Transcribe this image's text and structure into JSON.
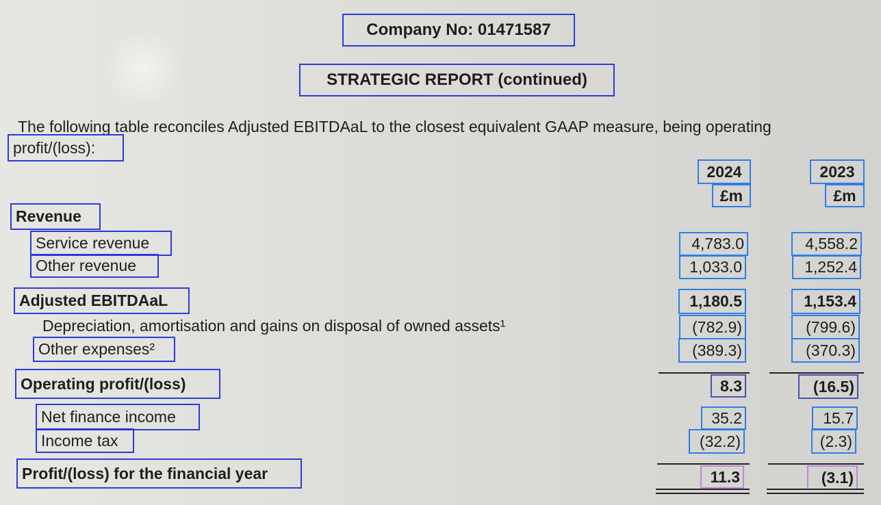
{
  "header": {
    "company_no": "Company No: 01471587",
    "report_title": "STRATEGIC REPORT (continued)"
  },
  "intro": {
    "line1": "The following table reconciles Adjusted EBITDAaL to the closest equivalent GAAP measure, being operating",
    "line2": "profit/(loss):"
  },
  "columns": [
    {
      "year": "2024",
      "unit": "£m"
    },
    {
      "year": "2023",
      "unit": "£m"
    }
  ],
  "rows": {
    "revenue": {
      "label": "Revenue"
    },
    "service_revenue": {
      "label": "Service revenue",
      "v2024": "4,783.0",
      "v2023": "4,558.2"
    },
    "other_revenue": {
      "label": "Other revenue",
      "v2024": "1,033.0",
      "v2023": "1,252.4"
    },
    "adjusted_ebitdaal": {
      "label": "Adjusted EBITDAaL",
      "v2024": "1,180.5",
      "v2023": "1,153.4"
    },
    "depreciation": {
      "label": "Depreciation, amortisation and gains on disposal of owned assets¹",
      "v2024": "(782.9)",
      "v2023": "(799.6)"
    },
    "other_expenses": {
      "label": "Other expenses²",
      "v2024": "(389.3)",
      "v2023": "(370.3)"
    },
    "operating_profit": {
      "label": "Operating profit/(loss)",
      "v2024": "8.3",
      "v2023": "(16.5)"
    },
    "net_finance_income": {
      "label": "Net finance income",
      "v2024": "35.2",
      "v2023": "15.7"
    },
    "income_tax": {
      "label": "Income tax",
      "v2024": "(32.2)",
      "v2023": "(2.3)"
    },
    "profit_for_year": {
      "label": "Profit/(loss) for the financial year",
      "v2024": "11.3",
      "v2023": "(3.1)"
    }
  }
}
